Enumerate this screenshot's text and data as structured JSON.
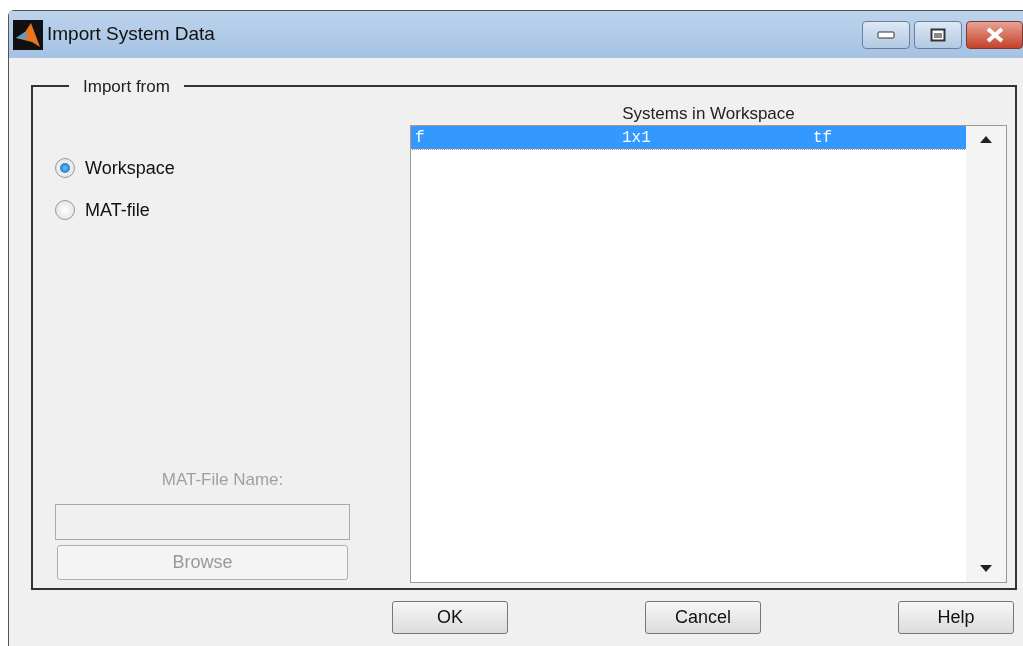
{
  "window": {
    "title": "Import System Data"
  },
  "import_from": {
    "title": "Import from",
    "sources": [
      {
        "label": "Workspace",
        "selected": true
      },
      {
        "label": "MAT-file",
        "selected": false
      }
    ],
    "mat_file": {
      "label": "MAT-File Name:",
      "disabled": true,
      "browse": "Browse"
    }
  },
  "systems": {
    "title": "Systems in Workspace",
    "rows": [
      {
        "name": "f",
        "size": "1x1",
        "type": "tf",
        "selected": true
      }
    ]
  },
  "buttons": [
    "OK",
    "Cancel",
    "Help"
  ]
}
